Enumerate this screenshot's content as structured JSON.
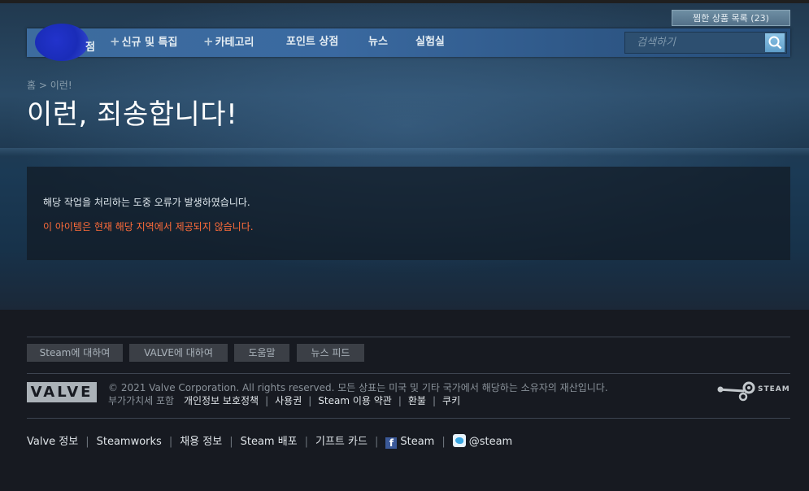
{
  "wishlist": {
    "label": "찜한 상품 목록 (23)"
  },
  "nav": {
    "first_tail": "점",
    "items": [
      {
        "label": "신규 및 특집",
        "plus": "+"
      },
      {
        "label": "카테고리",
        "plus": "+"
      },
      {
        "label": "포인트 상점",
        "plus": ""
      },
      {
        "label": "뉴스",
        "plus": ""
      },
      {
        "label": "실험실",
        "plus": ""
      }
    ],
    "search_placeholder": "검색하기"
  },
  "breadcrumb": {
    "home": "홈",
    "separator": ">",
    "current": "이런!"
  },
  "page_title": "이런, 죄송합니다!",
  "error": {
    "message": "해당 작업을 처리하는 도중 오류가 발생하였습니다.",
    "detail": "이 아이템은 현재 해당 지역에서 제공되지 않습니다."
  },
  "footer": {
    "buttons": [
      "Steam에 대하여",
      "VALVE에 대하여",
      "도움말",
      "뉴스 피드"
    ],
    "valve_logo": "VALVE",
    "copyright": "© 2021 Valve Corporation. All rights reserved. 모든 상표는 미국 및 기타 국가에서 해당하는 소유자의 재산입니다.",
    "vat_text": "부가가치세 포함",
    "legal_links": [
      "개인정보 보호정책",
      "사용권",
      "Steam 이용 약관",
      "환불",
      "쿠키"
    ],
    "steam_logo": "STEAM",
    "bottom_links": [
      "Valve 정보",
      "Steamworks",
      "채용 정보",
      "Steam 배포",
      "기프트 카드"
    ],
    "facebook_label": "Steam",
    "twitter_label": "@steam"
  },
  "colors": {
    "background": "#171a21",
    "nav_blue": "#3d6c9e",
    "error_orange": "#ff6c3a",
    "title_white": "#ffffff"
  }
}
